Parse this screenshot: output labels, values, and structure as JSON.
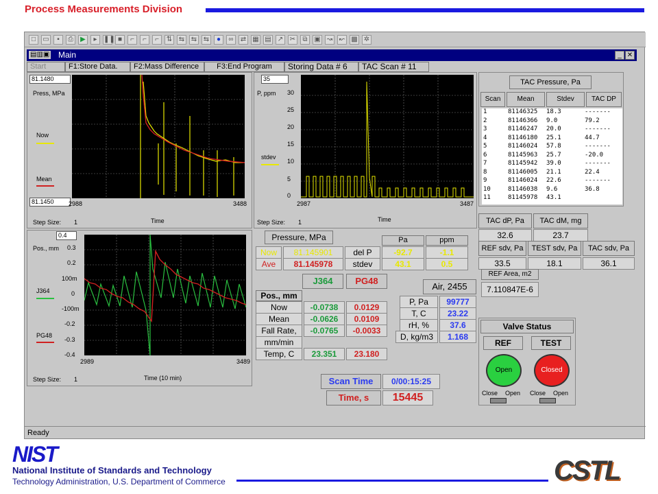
{
  "header": {
    "title": "Process Measurements Division"
  },
  "window": {
    "title": "Main"
  },
  "menu": {
    "start": "Start",
    "f1": "F1:Store Data.",
    "f2": "F2:Mass Difference",
    "f3": "F3:End Program",
    "storing": "Storing Data # 6",
    "tacscan": "TAC Scan # 11"
  },
  "plot1": {
    "ymax_box": "81.1480",
    "ymin_box": "81.1450",
    "ylabel": "Press, MPa",
    "now": "Now",
    "mean": "Mean",
    "xmin": "2988",
    "xmax": "3488",
    "xlabel": "Time",
    "step_label": "Step Size:",
    "step": "1"
  },
  "plot2": {
    "box": "35",
    "ylabel": "P, ppm",
    "stdev": "stdev",
    "yticks": [
      "30",
      "25",
      "20",
      "15",
      "10",
      "5",
      "0"
    ],
    "xmin": "2987",
    "xmax": "3487",
    "xlabel": "Time",
    "step_label": "Step Size:",
    "step": "1"
  },
  "plot3": {
    "box": "0.4",
    "ylabel": "Pos., mm",
    "j364": "J364",
    "pg48": "PG48",
    "yticks": [
      "0.3",
      "0.2",
      "100m",
      "0",
      "-100m",
      "-0.2",
      "-0.3",
      "-0.4"
    ],
    "xmin": "2989",
    "xmax": "3489",
    "xlabel": "Time (10 min)",
    "step_label": "Step Size:",
    "step": "1"
  },
  "pressure": {
    "header": "Pressure, MPa",
    "now_label": "Now",
    "now_val": "81.145901",
    "ave_label": "Ave",
    "ave_val": "81.145978",
    "delp": "del P",
    "stdev": "stdev",
    "pa": "Pa",
    "ppm": "ppm",
    "delp_pa": "-92.7",
    "delp_ppm": "-1.1",
    "std_pa": "43.1",
    "std_ppm": "0.5"
  },
  "pos": {
    "j364": "J364",
    "pg48": "PG48",
    "header": "Pos., mm",
    "rows": [
      {
        "label": "Now",
        "a": "-0.0738",
        "b": "0.0129"
      },
      {
        "label": "Mean",
        "a": "-0.0626",
        "b": "0.0109"
      },
      {
        "label": "Fall Rate,",
        "a": "-0.0765",
        "b": "-0.0033"
      }
    ],
    "unit": "mm/min",
    "temp_label": "Temp, C",
    "temp_a": "23.351",
    "temp_b": "23.180"
  },
  "air": {
    "header": "Air, 2455",
    "rows": [
      {
        "label": "P, Pa",
        "val": "99777"
      },
      {
        "label": "T, C",
        "val": "23.22"
      },
      {
        "label": "rH, %",
        "val": "37.6"
      },
      {
        "label": "D, kg/m3",
        "val": "1.168"
      }
    ]
  },
  "scan": {
    "label": "Scan Time",
    "value": "0/00:15:25",
    "time_label": "Time, s",
    "time_value": "15445"
  },
  "tac": {
    "header": "TAC Pressure, Pa",
    "cols": [
      "Scan",
      "Mean",
      "Stdev",
      "TAC DP"
    ],
    "rows": [
      [
        "1",
        "81146325",
        "18.3",
        "-------"
      ],
      [
        "2",
        "81146366",
        "9.0",
        "79.2"
      ],
      [
        "3",
        "81146247",
        "20.0",
        "-------"
      ],
      [
        "4",
        "81146180",
        "25.1",
        "44.7"
      ],
      [
        "5",
        "81146024",
        "57.8",
        "-------"
      ],
      [
        "6",
        "81145963",
        "25.7",
        "-20.0"
      ],
      [
        "7",
        "81145942",
        "39.0",
        "-------"
      ],
      [
        "8",
        "81146005",
        "21.1",
        "22.4"
      ],
      [
        "9",
        "81146024",
        "22.6",
        "-------"
      ],
      [
        "10",
        "81146038",
        "9.6",
        "36.8"
      ],
      [
        "11",
        "81145978",
        "43.1",
        ""
      ]
    ]
  },
  "tacstats": {
    "dp_label": "TAC dP, Pa",
    "dp": "32.6",
    "dm_label": "TAC dM, mg",
    "dm": "23.7",
    "ref_label": "REF sdv, Pa",
    "ref": "33.5",
    "test_label": "TEST sdv, Pa",
    "test": "18.1",
    "tacsdv_label": "TAC sdv, Pa",
    "tacsdv": "36.1",
    "area_label": "REF Area, m2",
    "area": "7.110847E-6"
  },
  "valve": {
    "header": "Valve Status",
    "ref": "REF",
    "test": "TEST",
    "ref_state": "Open",
    "test_state": "Closed",
    "close": "Close",
    "open": "Open"
  },
  "status": {
    "text": "Ready"
  },
  "footer": {
    "nist": "NIST",
    "org": "National Institute of Standards and Technology",
    "sub": "Technology Administration, U.S. Department of Commerce",
    "logo": "CSTL"
  }
}
